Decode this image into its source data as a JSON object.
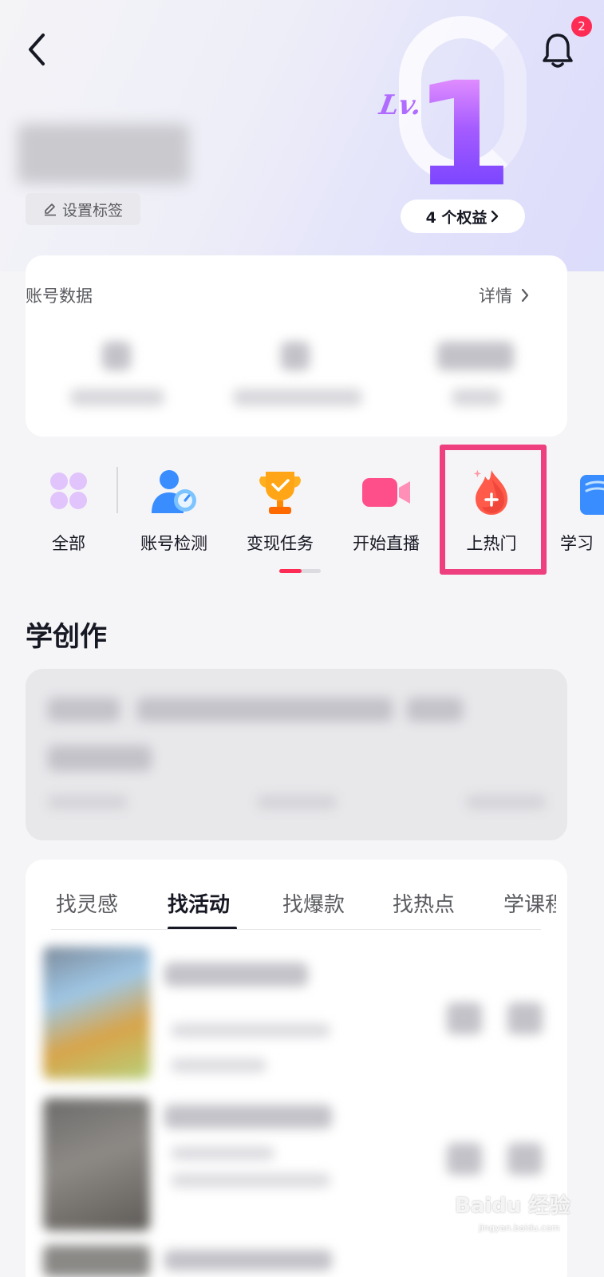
{
  "header": {
    "bell_badge_count": "2",
    "level": {
      "prefix": "Lv.",
      "number": "1"
    },
    "benefits_label": "4 个权益",
    "tag_button_label": "设置标签"
  },
  "stats": {
    "title": "账号数据",
    "detail_label": "详情"
  },
  "shortcuts": [
    {
      "label": "全部",
      "icon": "grid-icon"
    },
    {
      "label": "账号检测",
      "icon": "account-check-icon"
    },
    {
      "label": "变现任务",
      "icon": "trophy-icon"
    },
    {
      "label": "开始直播",
      "icon": "video-camera-icon"
    },
    {
      "label": "上热门",
      "icon": "flame-plus-icon"
    },
    {
      "label": "学习",
      "icon": "book-icon"
    }
  ],
  "learn": {
    "section_title": "学创作"
  },
  "tabs": [
    {
      "label": "找灵感",
      "active": false
    },
    {
      "label": "找活动",
      "active": true
    },
    {
      "label": "找爆款",
      "active": false
    },
    {
      "label": "找热点",
      "active": false
    },
    {
      "label": "学课程",
      "active": false
    }
  ],
  "watermark": {
    "main": "Baidu 经验",
    "sub": "jingyan.baidu.com"
  },
  "colors": {
    "accent": "#fe2c55",
    "highlight": "#ee3f7e",
    "level_purple": "#8b4dff"
  }
}
